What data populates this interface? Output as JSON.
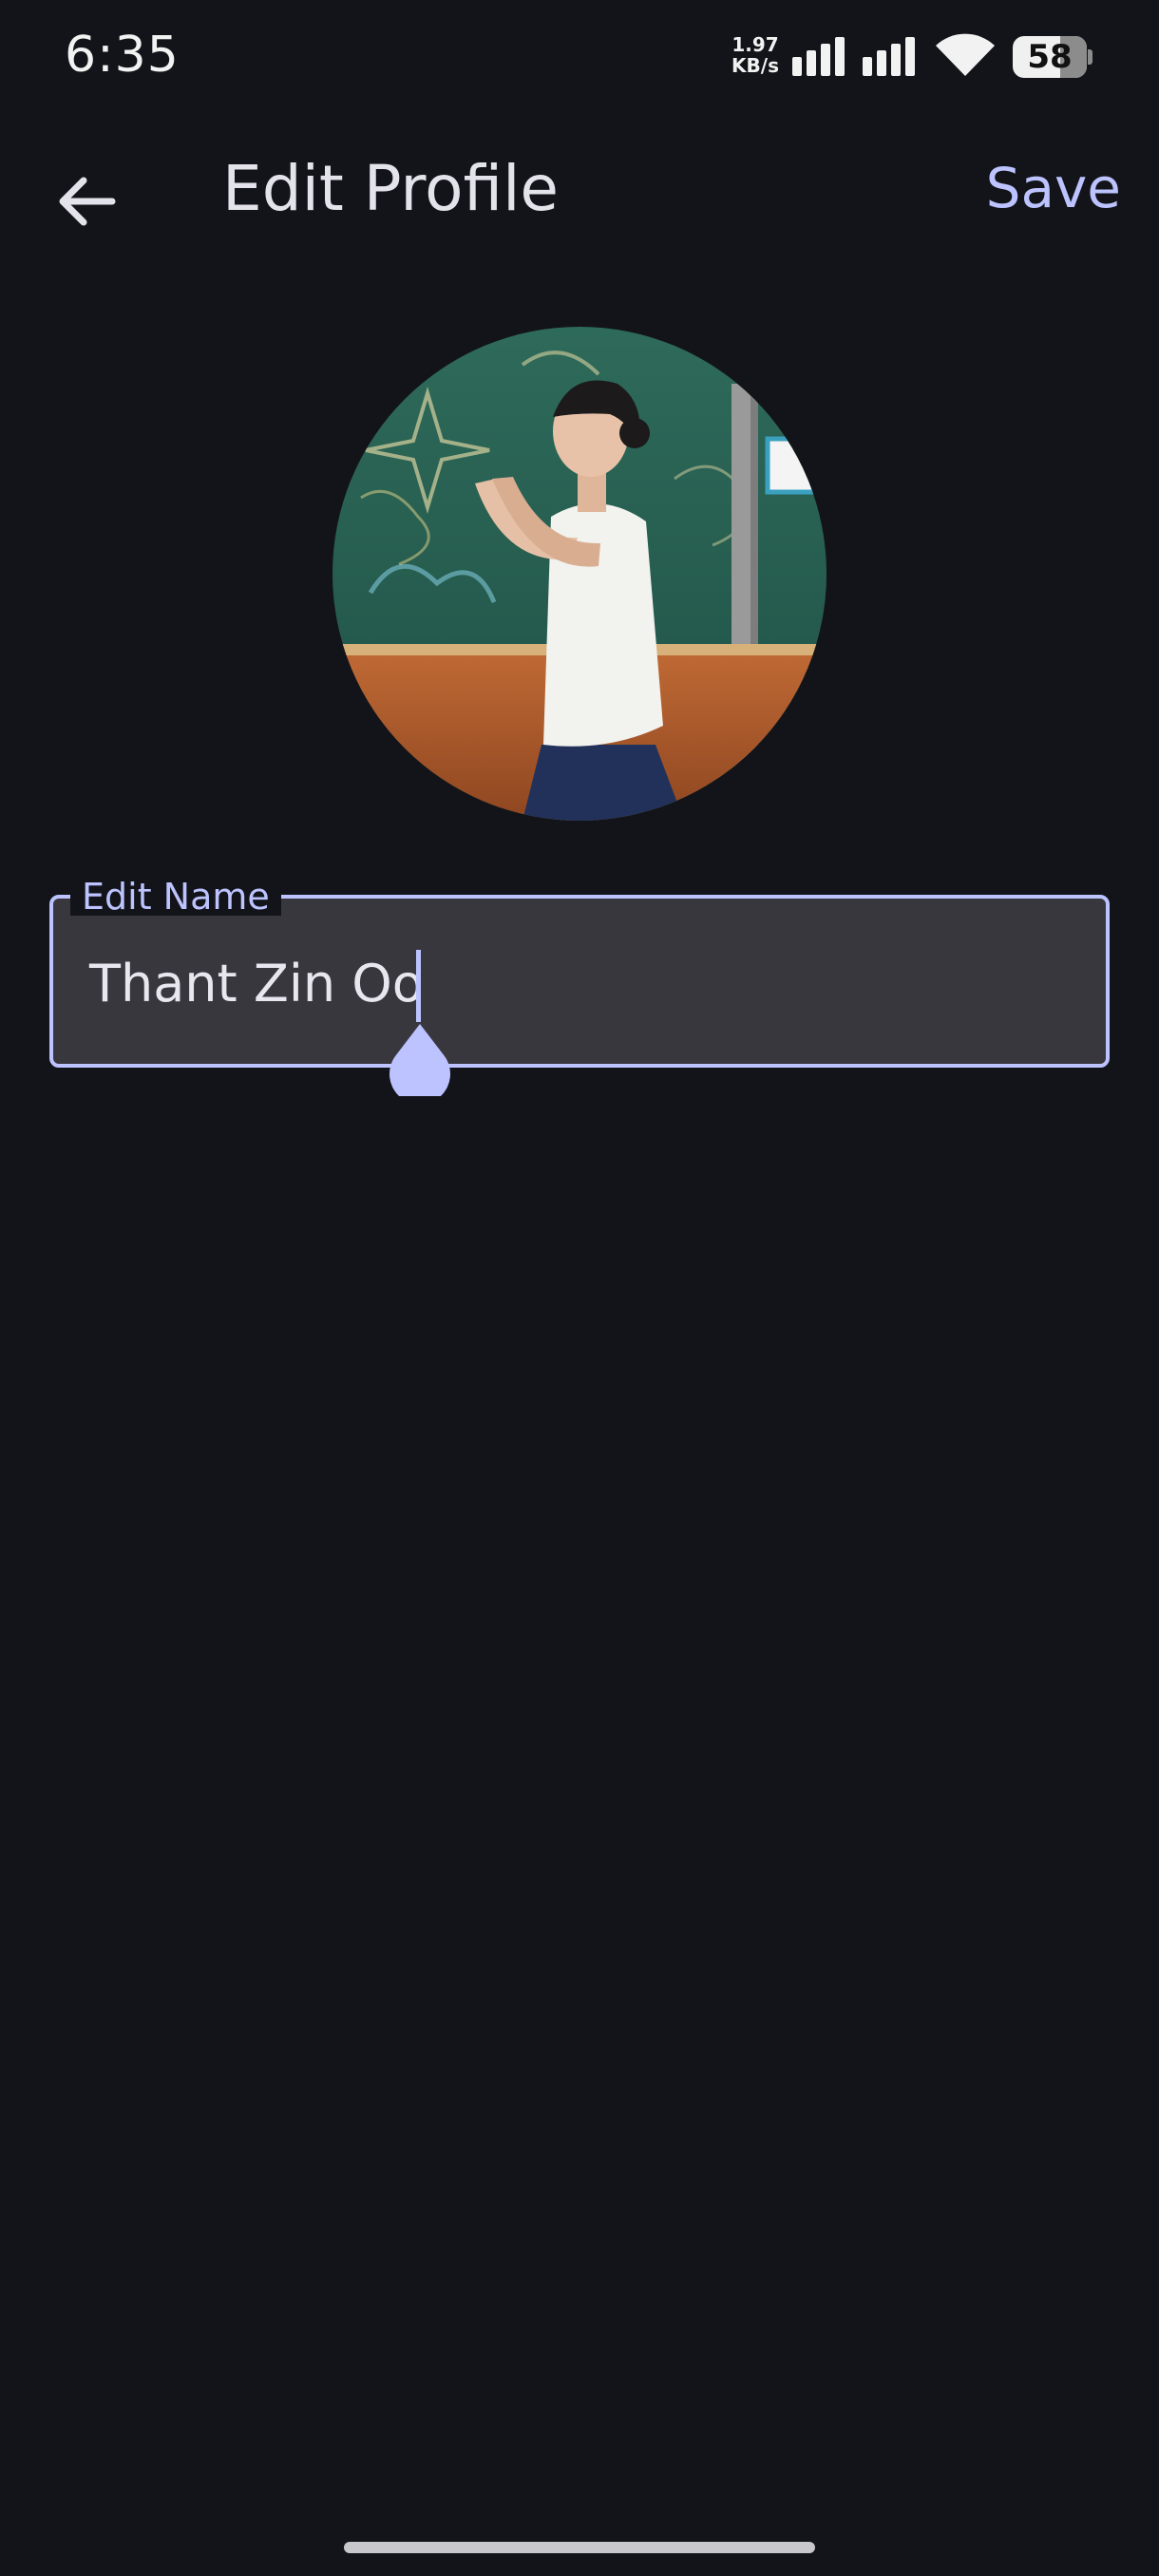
{
  "status_bar": {
    "time": "6:35",
    "net_speed_value": "1.97",
    "net_speed_unit": "KB/s",
    "battery_level": "58",
    "icons": [
      "signal-icon",
      "signal-icon",
      "wifi-icon",
      "battery-icon"
    ]
  },
  "app_bar": {
    "back_icon": "arrow-left-icon",
    "title": "Edit Profile",
    "save_label": "Save"
  },
  "profile": {
    "avatar": "profile-photo"
  },
  "name_field": {
    "label": "Edit Name",
    "value": "Thant Zin Oo"
  },
  "colors": {
    "background": "#131419",
    "accent": "#bcc3ff",
    "field_fill": "#38373e",
    "text_primary": "#e4e2ea"
  }
}
